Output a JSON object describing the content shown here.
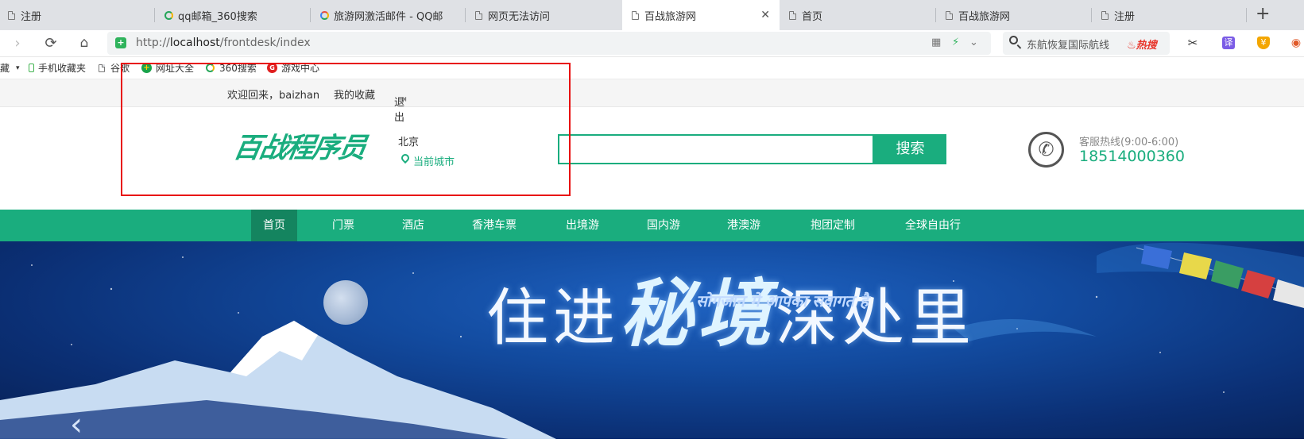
{
  "browser": {
    "tabs": [
      {
        "title": "注册",
        "icon": "doc-icon"
      },
      {
        "title": "qq邮箱_360搜索",
        "icon": "search-360-icon"
      },
      {
        "title": "旅游网激活邮件 - QQ邮",
        "icon": "chrome-icon"
      },
      {
        "title": "网页无法访问",
        "icon": "doc-icon"
      },
      {
        "title": "百战旅游网",
        "icon": "doc-icon",
        "active": true
      },
      {
        "title": "首页",
        "icon": "doc-icon"
      },
      {
        "title": "百战旅游网",
        "icon": "doc-icon"
      },
      {
        "title": "注册",
        "icon": "doc-icon"
      }
    ],
    "url_prefix": "http://",
    "url_host": "localhost",
    "url_path": "/frontdesk/index",
    "search_hint": "东航恢复国际航线",
    "hot_label": "热搜",
    "translate_label": "译",
    "bookmarks": [
      {
        "label": "藏"
      },
      {
        "label": "手机收藏夹"
      },
      {
        "label": "谷歌"
      },
      {
        "label": "网址大全"
      },
      {
        "label": "360搜索"
      },
      {
        "label": "游戏中心"
      }
    ]
  },
  "site": {
    "welcome": "欢迎回来，baizhan",
    "favorites": "我的收藏",
    "logout": "退出",
    "logo_text": "百战程序员",
    "city": "北京",
    "current_city": "当前城市",
    "search_button": "搜索",
    "search_value": "",
    "hotline_label": "客服热线(9:00-6:00)",
    "hotline_number": "18514000360",
    "nav": [
      "首页",
      "门票",
      "酒店",
      "香港车票",
      "出境游",
      "国内游",
      "港澳游",
      "抱团定制",
      "全球自由行"
    ],
    "active_nav": "首页",
    "banner_title_a": "住进",
    "banner_title_hl1": "秘",
    "banner_title_hl2": "境",
    "banner_title_b": "深处里",
    "banner_subtitle": "सोगजान मे आपका सवागत है"
  },
  "colors": {
    "brand": "#1aad7e",
    "nav_active": "#14845f",
    "annotation": "#e81010"
  }
}
